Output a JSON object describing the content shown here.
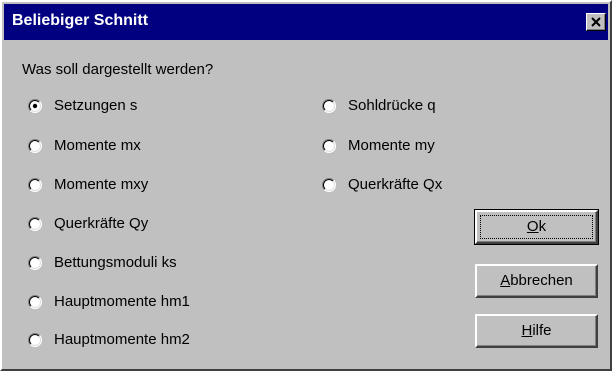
{
  "window": {
    "title": "Beliebiger Schnitt"
  },
  "prompt": "Was soll dargestellt werden?",
  "options": [
    {
      "label": "Setzungen s",
      "selected": true
    },
    {
      "label": "Momente mx",
      "selected": false
    },
    {
      "label": "Momente mxy",
      "selected": false
    },
    {
      "label": "Querkräfte Qy",
      "selected": false
    },
    {
      "label": "Bettungsmoduli ks",
      "selected": false
    },
    {
      "label": "Hauptmomente hm1",
      "selected": false
    },
    {
      "label": "Hauptmomente hm2",
      "selected": false
    },
    {
      "label": "Sohldrücke q",
      "selected": false
    },
    {
      "label": "Momente my",
      "selected": false
    },
    {
      "label": "Querkräfte Qx",
      "selected": false
    }
  ],
  "buttons": {
    "ok": {
      "label": "Ok",
      "accel": "O",
      "rest": "k"
    },
    "cancel": {
      "label": "Abbrechen",
      "accel": "A",
      "rest": "bbrechen"
    },
    "help": {
      "label": "Hilfe",
      "accel": "H",
      "rest": "ilfe"
    }
  },
  "colors": {
    "titlebar": "#000080",
    "face": "#c0c0c0"
  }
}
